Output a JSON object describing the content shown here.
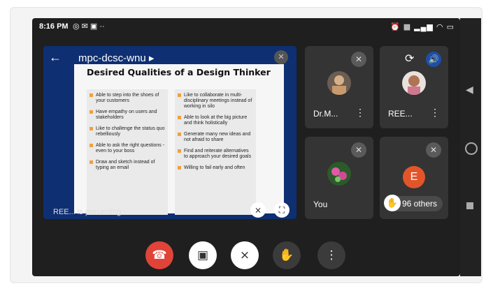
{
  "status_bar": {
    "time": "8:16 PM",
    "left_icons": [
      "whatsapp-icon",
      "gmail-icon",
      "message-icon",
      "dots-icon"
    ],
    "right_icons": [
      "alarm-icon",
      "signal-icon",
      "wifi-icon",
      "battery-icon"
    ]
  },
  "meeting": {
    "code": "mpc-dcsc-wnu",
    "presenting_text": "REE... is presenting"
  },
  "slide": {
    "title": "Desired Qualities of a Design Thinker",
    "left_items": [
      "Able to step into the shoes of your customers",
      "Have empathy on users and stakeholders",
      "Like to challenge the status quo rebelliously",
      "Able to ask the right questions - even to your boss",
      "Draw and sketch instead of typing an email"
    ],
    "right_items": [
      "Like to collaborate in multi-disciplinary meetings instead of working in silo",
      "Able to look at the big picture and think holistically",
      "Generate many new ideas and not afraid to share",
      "Find and reiterate alternatives to approach your desired goals",
      "Willing to fail early and often"
    ]
  },
  "participants": {
    "tile1": {
      "name": "Dr.M..."
    },
    "tile2": {
      "name": "REE..."
    },
    "tile3": {
      "name": "You"
    },
    "tile4": {
      "initial": "E",
      "others": "96 others"
    }
  },
  "colors": {
    "end_call": "#e04438",
    "slide_background": "#0e2f72",
    "bullet": "#f0a040",
    "avatar_e": "#e2552b"
  }
}
